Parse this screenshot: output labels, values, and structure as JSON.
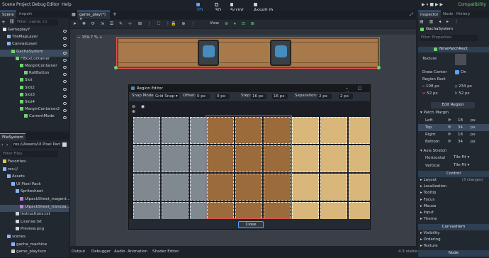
{
  "menu": [
    "Scene",
    "Project",
    "Debug",
    "Editor",
    "Help"
  ],
  "main_buttons": {
    "2d": "2D",
    "3d": "3D",
    "script": "Script",
    "assetlib": "AssetLib"
  },
  "renderer": "Compatibility",
  "scene_dock": {
    "tabs": [
      "Scene",
      "Import"
    ],
    "filter_placeholder": "Filter: name, t:t",
    "tree": [
      {
        "label": "GameplayY",
        "depth": 0
      },
      {
        "label": "TileMapLayer",
        "depth": 1
      },
      {
        "label": "CanvasLayer",
        "depth": 1
      },
      {
        "label": "GachaSystem",
        "depth": 2
      },
      {
        "label": "HBoxContainer",
        "depth": 3
      },
      {
        "label": "MarginContainer",
        "depth": 4
      },
      {
        "label": "RollButton",
        "depth": 5
      },
      {
        "label": "Slot",
        "depth": 4
      },
      {
        "label": "Slot2",
        "depth": 4
      },
      {
        "label": "Slot3",
        "depth": 4
      },
      {
        "label": "Slot4",
        "depth": 4
      },
      {
        "label": "MarginContainer2",
        "depth": 4
      },
      {
        "label": "CurrentMode",
        "depth": 5
      }
    ]
  },
  "file_dock": {
    "title": "FileSystem",
    "path": "res://Assets/UI Pixel Pack/S",
    "filter_placeholder": "Filter Files",
    "items": [
      {
        "label": "Favorites:",
        "depth": 0
      },
      {
        "label": "res://",
        "depth": 0
      },
      {
        "label": "Assets",
        "depth": 1
      },
      {
        "label": "UI Pixel Pack",
        "depth": 2
      },
      {
        "label": "Spritesheet",
        "depth": 3
      },
      {
        "label": "UIpackSheet_magent...",
        "depth": 4
      },
      {
        "label": "UIpackSheet_transpa...",
        "depth": 4
      },
      {
        "label": "Instructions.txt",
        "depth": 3
      },
      {
        "label": "License.txt",
        "depth": 3
      },
      {
        "label": "Preview.png",
        "depth": 3
      },
      {
        "label": "scenes",
        "depth": 1
      },
      {
        "label": "gacha_machine",
        "depth": 2
      },
      {
        "label": "game_play.tscn",
        "depth": 2
      }
    ]
  },
  "editor_tab": "game_play(*)",
  "toolbar": {
    "view": "View",
    "zoom": "159.7 %"
  },
  "bottom_tabs": [
    "Output",
    "Debugger",
    "Audio",
    "Animation",
    "Shader Editor"
  ],
  "version": "4.3.stable",
  "dialog": {
    "title": "Region Editor",
    "snap_mode_label": "Snap Mode:",
    "snap_mode_value": "Grid Snap",
    "offset_label": "Offset:",
    "offset_x": "0 px",
    "offset_y": "0 px",
    "step_label": "Step:",
    "step_x": "16 px",
    "step_y": "16 px",
    "separation_label": "Separation:",
    "separation_x": "2 px",
    "separation_y": "2 px",
    "close": "Close"
  },
  "inspector": {
    "tabs": [
      "Inspector",
      "Node",
      "History"
    ],
    "node": "GachaSystem",
    "filter_placeholder": "Filter Properties",
    "resource": "NinePatchRect",
    "texture_label": "Texture",
    "draw_center_label": "Draw Center",
    "draw_center_value": "On",
    "region_rect_label": "Region Rect",
    "region": {
      "x": "108",
      "y": "234",
      "w": "52",
      "h": "52"
    },
    "units": "px",
    "edit_region": "Edit Region",
    "patch_margin": "Patch Margin",
    "margins": [
      {
        "label": "Left",
        "value": "18"
      },
      {
        "label": "Top",
        "value": "34"
      },
      {
        "label": "Right",
        "value": "18"
      },
      {
        "label": "Bottom",
        "value": "34"
      }
    ],
    "axis_stretch": "Axis Stretch",
    "horizontal_label": "Horizontal",
    "horizontal_value": "Tile Fit",
    "vertical_label": "Vertical",
    "vertical_value": "Tile Fit",
    "control_section": "Control",
    "control_groups": [
      "Layout",
      "Localization",
      "Tooltip",
      "Focus",
      "Mouse",
      "Input",
      "Theme"
    ],
    "layout_changes": "(3 changes)",
    "canvasitem_section": "CanvasItem",
    "canvas_groups": [
      "Visibility",
      "Ordering",
      "Texture",
      "Material"
    ],
    "node_section": "Node"
  },
  "colors": {
    "accent": "#5aa2ff",
    "bg": "#1d2229",
    "panel": "#222830"
  }
}
